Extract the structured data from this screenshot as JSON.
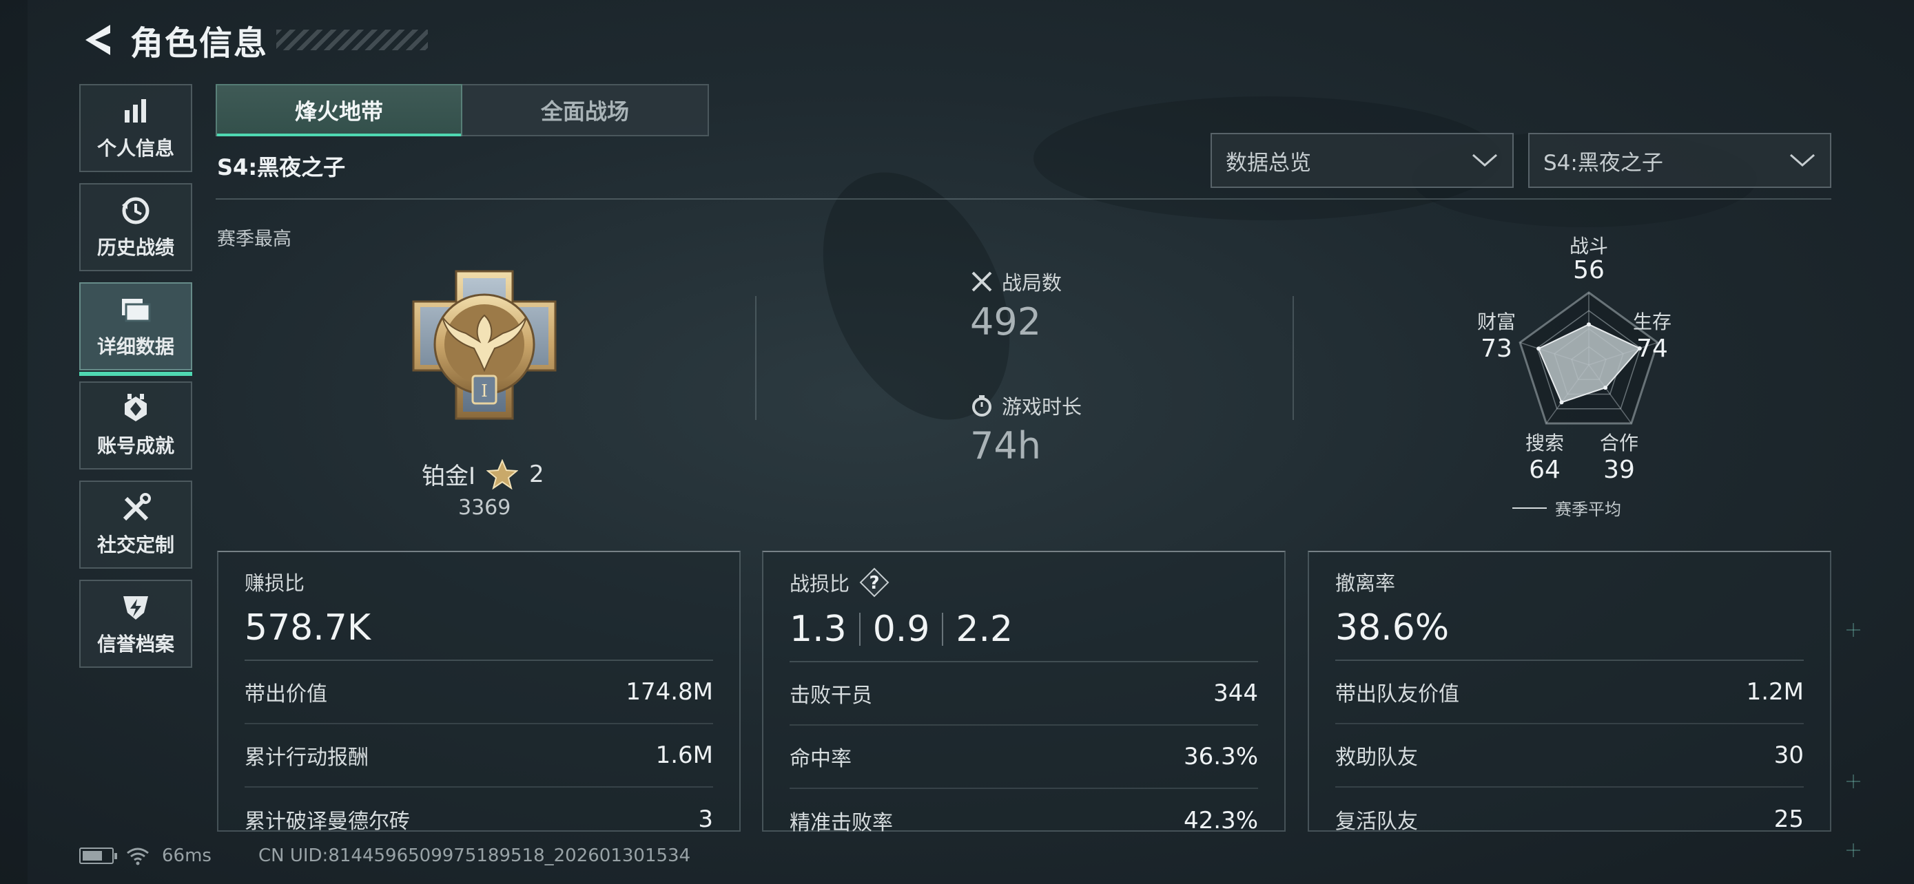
{
  "header": {
    "title": "角色信息"
  },
  "sidebar": {
    "items": [
      {
        "label": "个人信息",
        "icon": "bar-chart-icon",
        "active": false
      },
      {
        "label": "历史战绩",
        "icon": "history-clock-icon",
        "active": false
      },
      {
        "label": "详细数据",
        "icon": "folder-icon",
        "active": true
      },
      {
        "label": "账号成就",
        "icon": "achievement-badge-icon",
        "active": false
      },
      {
        "label": "社交定制",
        "icon": "tools-icon",
        "active": false
      },
      {
        "label": "信誉档案",
        "icon": "shield-bolt-icon",
        "active": false
      }
    ]
  },
  "tabs": [
    {
      "label": "烽火地带",
      "active": true
    },
    {
      "label": "全面战场",
      "active": false
    }
  ],
  "season_title": "S4:黑夜之子",
  "filters": {
    "view": "数据总览",
    "season": "S4:黑夜之子"
  },
  "season_best": {
    "label": "赛季最高",
    "rank_name": "铂金Ⅰ",
    "stars": "2",
    "score": "3369"
  },
  "overview": {
    "matches_label": "战局数",
    "matches_value": "492",
    "playtime_label": "游戏时长",
    "playtime_value": "74h"
  },
  "radar": {
    "axes": [
      {
        "label": "战斗",
        "value": 56
      },
      {
        "label": "生存",
        "value": 74
      },
      {
        "label": "合作",
        "value": 39
      },
      {
        "label": "搜索",
        "value": 64
      },
      {
        "label": "财富",
        "value": 73
      }
    ],
    "max": 100,
    "legend": "赛季平均"
  },
  "cards": [
    {
      "title": "赚损比",
      "main": "578.7K",
      "rows": [
        {
          "label": "带出价值",
          "value": "174.8M"
        },
        {
          "label": "累计行动报酬",
          "value": "1.6M"
        },
        {
          "label": "累计破译曼德尔砖",
          "value": "3"
        }
      ]
    },
    {
      "title": "战损比",
      "main_parts": [
        "1.3",
        "0.9",
        "2.2"
      ],
      "rows": [
        {
          "label": "击败干员",
          "value": "344"
        },
        {
          "label": "命中率",
          "value": "36.3%"
        },
        {
          "label": "精准击败率",
          "value": "42.3%"
        }
      ]
    },
    {
      "title": "撤离率",
      "main": "38.6%",
      "rows": [
        {
          "label": "带出队友价值",
          "value": "1.2M"
        },
        {
          "label": "救助队友",
          "value": "30"
        },
        {
          "label": "复活队友",
          "value": "25"
        }
      ]
    }
  ],
  "footer": {
    "ping": "66ms",
    "uid": "CN UID:8144596509975189518_202601301534"
  },
  "colors": {
    "accent": "#4fd8b2",
    "background": "#1f2a30",
    "radar_fill": "#b9c2c6"
  }
}
